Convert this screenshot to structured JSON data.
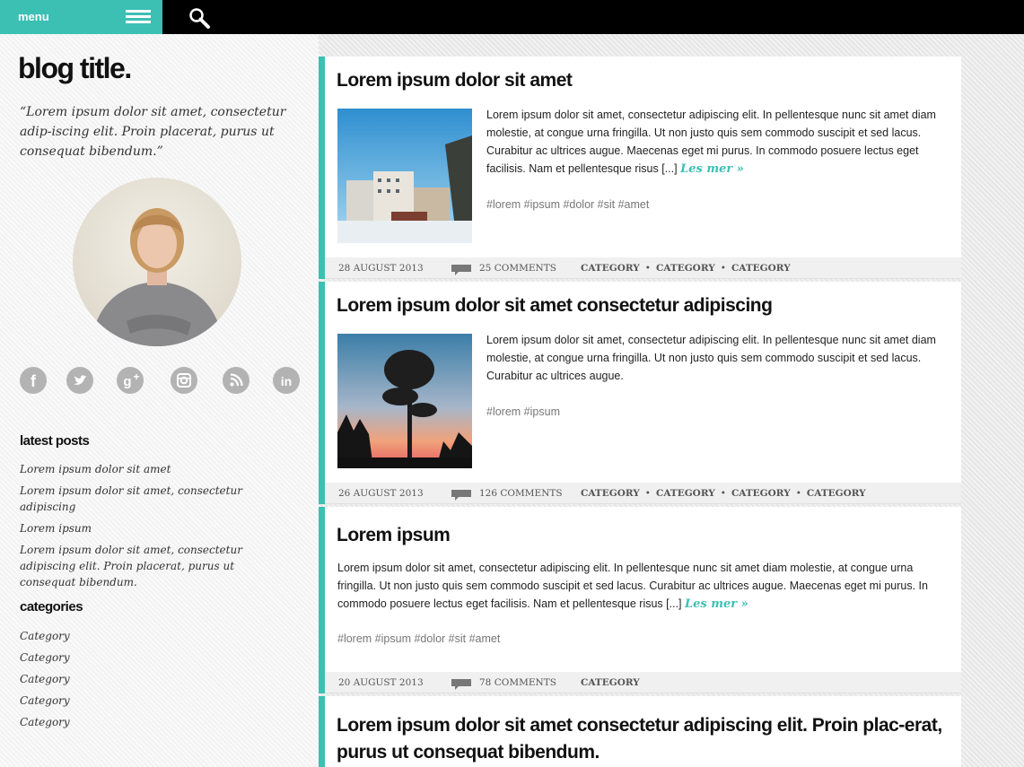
{
  "topbar": {
    "menu_label": "menu"
  },
  "sidebar": {
    "title": "blog title.",
    "tagline": "“Lorem ipsum dolor sit amet, consectetur adip-iscing elit. Proin placerat, purus ut consequat bibendum.”",
    "social": [
      "facebook-icon",
      "twitter-icon",
      "google-plus-icon",
      "instagram-icon",
      "rss-icon",
      "linkedin-icon"
    ],
    "latest_heading": "latest posts",
    "latest": [
      "Lorem ipsum dolor sit amet",
      "Lorem ipsum dolor sit amet, consectetur adipiscing",
      "Lorem ipsum",
      "Lorem ipsum dolor sit amet, consectetur adipiscing elit. Proin placerat, purus ut consequat bibendum."
    ],
    "categories_heading": "categories",
    "categories": [
      "Category",
      "Category",
      "Category",
      "Category",
      "Category"
    ]
  },
  "posts": [
    {
      "title": "Lorem ipsum dolor sit amet",
      "excerpt": "Lorem ipsum dolor sit amet, consectetur adipiscing elit. In pellentesque nunc sit amet diam molestie, at congue urna fringilla. Ut non justo quis sem commodo suscipit et sed lacus. Curabitur ac ultrices augue. Maecenas eget mi purus. In commodo posuere lectus eget facilisis. Nam et pellentesque risus [...]",
      "read_more": "Les mer »",
      "tags": "#lorem #ipsum #dolor #sit #amet",
      "date": "28 AUGUST 2013",
      "comments": "25 COMMENTS",
      "categories": [
        "CATEGORY",
        "CATEGORY",
        "CATEGORY"
      ]
    },
    {
      "title": "Lorem ipsum dolor sit amet consectetur adipiscing",
      "excerpt": "Lorem ipsum dolor sit amet, consectetur adipiscing elit. In pellentesque nunc sit amet diam molestie, at congue urna fringilla. Ut non justo quis sem commodo suscipit et sed lacus. Curabitur ac ultrices augue.",
      "tags": "#lorem #ipsum",
      "date": "26 AUGUST 2013",
      "comments": "126 COMMENTS",
      "categories": [
        "CATEGORY",
        "CATEGORY",
        "CATEGORY",
        "CATEGORY"
      ]
    },
    {
      "title": "Lorem ipsum",
      "excerpt": "Lorem ipsum dolor sit amet, consectetur adipiscing elit. In pellentesque nunc sit amet diam molestie, at congue urna fringilla. Ut non justo quis sem commodo suscipit et sed lacus. Curabitur ac ultrices augue. Maecenas eget mi purus. In commodo posuere lectus eget facilisis. Nam et pellentesque risus [...]",
      "read_more": "Les mer »",
      "tags": "#lorem #ipsum #dolor #sit #amet",
      "date": "20 AUGUST 2013",
      "comments": "78 COMMENTS",
      "categories": [
        "CATEGORY"
      ]
    },
    {
      "title": "Lorem ipsum dolor sit amet consectetur adipiscing elit. Proin plac-erat, purus ut consequat bibendum."
    }
  ],
  "colors": {
    "accent": "#3cc0b4",
    "topbar": "#000000",
    "icon_grey": "#b3b3b3"
  }
}
